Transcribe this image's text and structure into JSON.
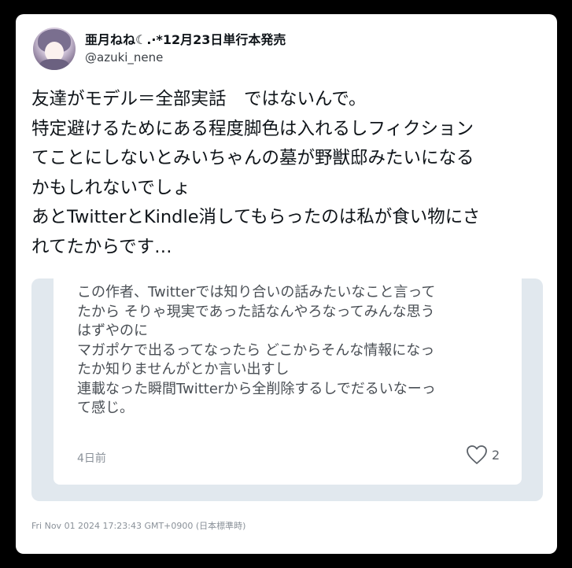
{
  "author": {
    "display_name": "亜月ねね☾.·*12月23日単行本発売",
    "handle": "@azuki_nene"
  },
  "tweet": {
    "text": "友達がモデル＝全部実話　ではないんで。\n特定避けるためにある程度脚色は入れるしフィクション\nてことにしないとみいちゃんの墓が野獣邸みたいになる\nかもしれないでしょ\nあとTwitterとKindle消してもらったのは私が食い物にさ\nれてたからです…"
  },
  "quote": {
    "text": "この作者、Twitterでは知り合いの話みたいなこと言って\nたから そりゃ現実であった話なんやろなってみんな思う\nはずやのに\nマガポケで出るってなったら どこからそんな情報になっ\nたか知りませんがとか言い出すし\n連載なった瞬間Twitterから全削除するしでだるいなーっ\nて感じ。",
    "time_ago": "4日前",
    "like_count": "2",
    "like_icon": "heart-outline-icon"
  },
  "footer": {
    "timestamp": "Fri Nov 01 2024 17:23:43 GMT+0900 (日本標準時)"
  },
  "colors": {
    "background": "#000000",
    "card": "#ffffff",
    "quote_frame": "#e1e8ee",
    "primary_text": "#0f1419",
    "secondary_text": "#8a9199"
  }
}
